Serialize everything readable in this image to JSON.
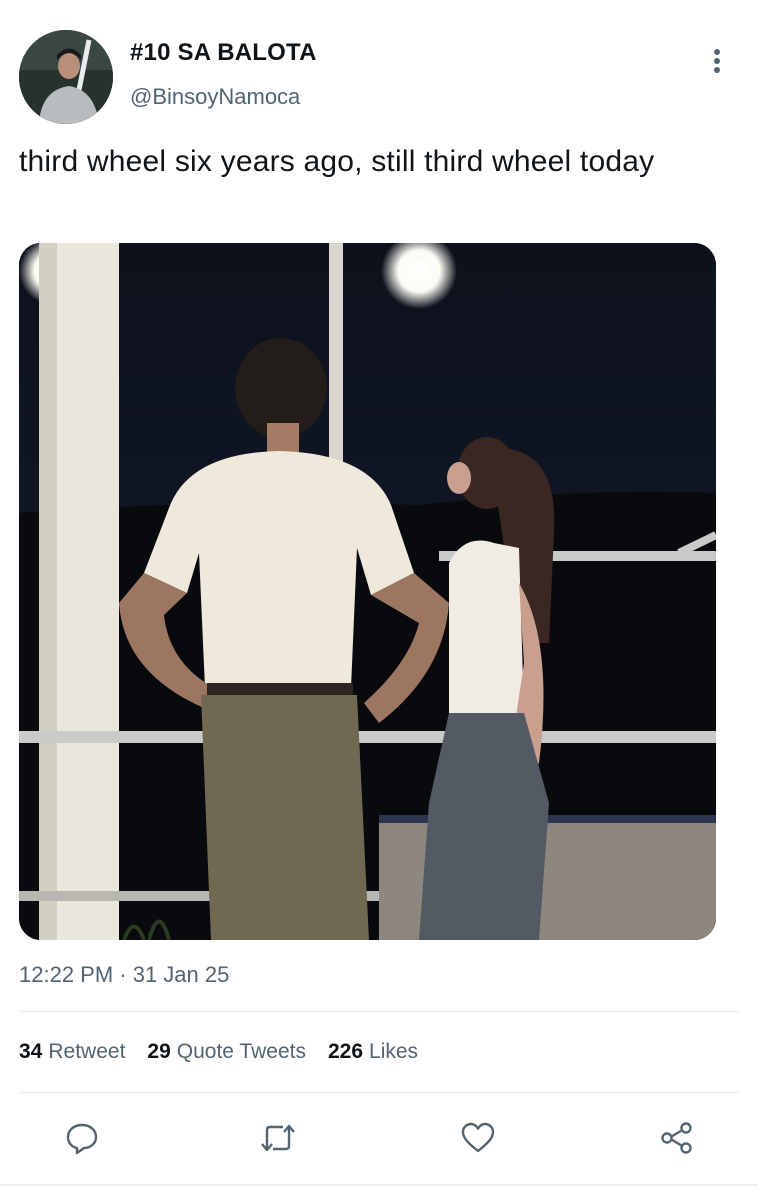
{
  "author": {
    "display_name": "#10 SA BALOTA",
    "handle": "@BinsoyNamoca"
  },
  "tweet": {
    "text": "third wheel six years ago, still third wheel today",
    "timestamp": "12:22 PM · 31 Jan 25"
  },
  "stats": {
    "retweets_count": "34",
    "retweets_label": "Retweet",
    "quotes_count": "29",
    "quotes_label": "Quote Tweets",
    "likes_count": "226",
    "likes_label": "Likes"
  },
  "icons": {
    "more": "more-vertical-icon",
    "reply": "reply-icon",
    "retweet": "retweet-icon",
    "like": "heart-icon",
    "share": "share-icon"
  },
  "colors": {
    "text_primary": "#0f1419",
    "text_secondary": "#536471",
    "divider": "#e1e6ea"
  }
}
